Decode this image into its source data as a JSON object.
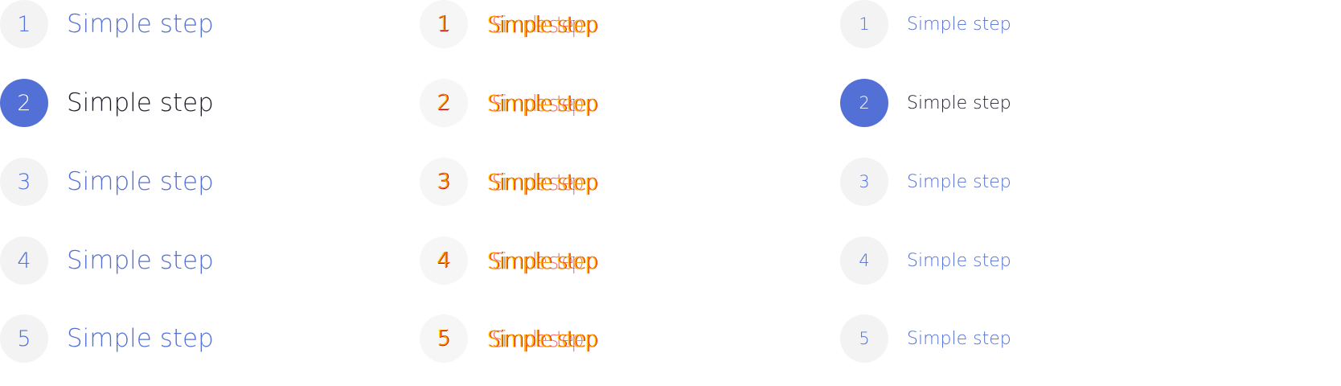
{
  "steppers": [
    {
      "variant": "large",
      "active_index": 1,
      "steps": [
        {
          "number": "1",
          "label": "Simple step"
        },
        {
          "number": "2",
          "label": "Simple step"
        },
        {
          "number": "3",
          "label": "Simple step"
        },
        {
          "number": "4",
          "label": "Simple step"
        },
        {
          "number": "5",
          "label": "Simple step"
        }
      ]
    },
    {
      "variant": "glitched",
      "active_index": -1,
      "steps": [
        {
          "number": "1",
          "label": "Simple step"
        },
        {
          "number": "2",
          "label": "Simple step"
        },
        {
          "number": "3",
          "label": "Simple step"
        },
        {
          "number": "4",
          "label": "Simple step"
        },
        {
          "number": "5",
          "label": "Simple step"
        }
      ]
    },
    {
      "variant": "small",
      "active_index": 1,
      "steps": [
        {
          "number": "1",
          "label": "Simple step"
        },
        {
          "number": "2",
          "label": "Simple step"
        },
        {
          "number": "3",
          "label": "Simple step"
        },
        {
          "number": "4",
          "label": "Simple step"
        },
        {
          "number": "5",
          "label": "Simple step"
        }
      ]
    }
  ],
  "colors": {
    "accent": "#5270d6",
    "active_text": "#1c1e2b",
    "inactive_circle": "#f3f3f3",
    "glitch_orange": "#ff9a00",
    "glitch_red": "#e00000"
  }
}
